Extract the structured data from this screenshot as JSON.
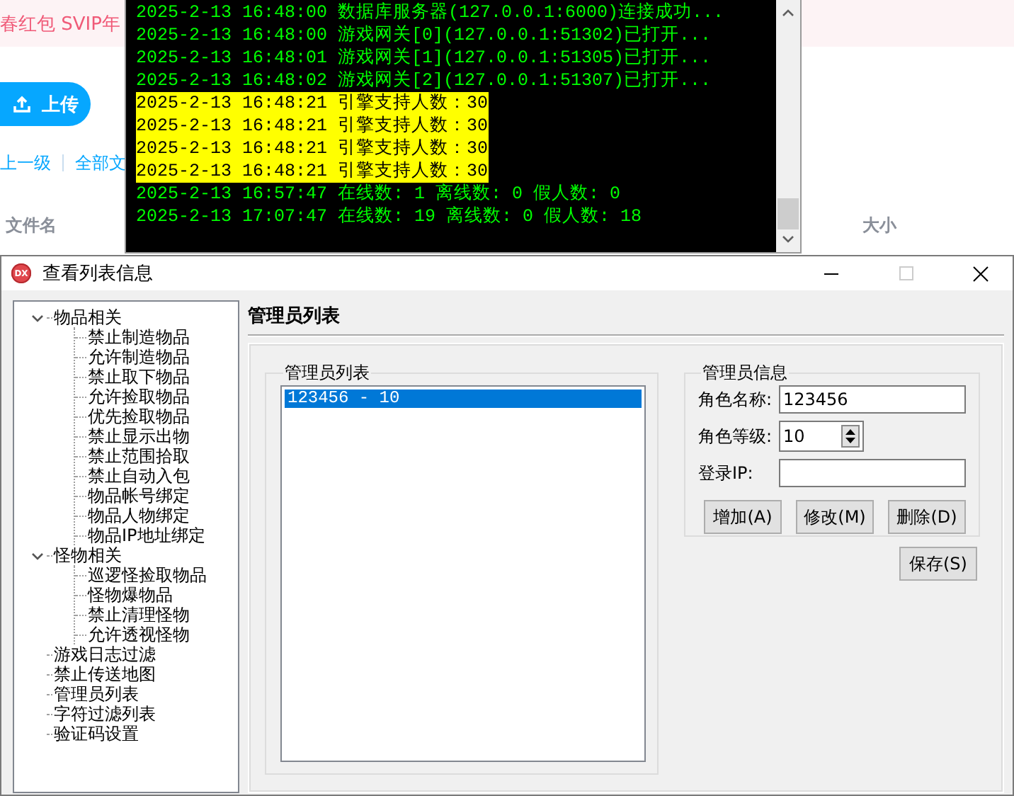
{
  "browser": {
    "promo_text": "春红包 SVIP年",
    "upload_button": "上传",
    "breadcrumb": [
      {
        "label": "上一级"
      },
      {
        "label": "全部文"
      }
    ],
    "columns": [
      "文件名",
      "大小"
    ]
  },
  "console": {
    "lines": [
      {
        "text": "2025-2-13 16:48:00 数据库服务器(127.0.0.1:6000)连接成功...",
        "highlighted": false
      },
      {
        "text": "2025-2-13 16:48:00 游戏网关[0](127.0.0.1:51302)已打开...",
        "highlighted": false
      },
      {
        "text": "2025-2-13 16:48:01 游戏网关[1](127.0.0.1:51305)已打开...",
        "highlighted": false
      },
      {
        "text": "2025-2-13 16:48:02 游戏网关[2](127.0.0.1:51307)已打开...",
        "highlighted": false
      },
      {
        "text": "2025-2-13 16:48:21 引擎支持人数：30",
        "highlighted": true
      },
      {
        "text": "2025-2-13 16:48:21 引擎支持人数：30",
        "highlighted": true
      },
      {
        "text": "2025-2-13 16:48:21 引擎支持人数：30",
        "highlighted": true
      },
      {
        "text": "2025-2-13 16:48:21 引擎支持人数：30",
        "highlighted": true
      },
      {
        "text": "2025-2-13 16:57:47 在线数: 1 离线数: 0 假人数: 0",
        "highlighted": false
      },
      {
        "text": "2025-2-13 17:07:47 在线数: 19 离线数: 0 假人数: 18",
        "highlighted": false
      }
    ]
  },
  "dialog": {
    "title": "查看列表信息",
    "icon_label": "DX",
    "tree": [
      {
        "label": "物品相关",
        "expanded": true,
        "children": [
          {
            "label": "禁止制造物品"
          },
          {
            "label": "允许制造物品"
          },
          {
            "label": "禁止取下物品"
          },
          {
            "label": "允许捡取物品"
          },
          {
            "label": "优先捡取物品"
          },
          {
            "label": "禁止显示出物"
          },
          {
            "label": "禁止范围拾取"
          },
          {
            "label": "禁止自动入包"
          },
          {
            "label": "物品帐号绑定"
          },
          {
            "label": "物品人物绑定"
          },
          {
            "label": "物品IP地址绑定"
          }
        ]
      },
      {
        "label": "怪物相关",
        "expanded": true,
        "children": [
          {
            "label": "巡逻怪捡取物品"
          },
          {
            "label": "怪物爆物品"
          },
          {
            "label": "禁止清理怪物"
          },
          {
            "label": "允许透视怪物"
          }
        ]
      },
      {
        "label": "游戏日志过滤"
      },
      {
        "label": "禁止传送地图"
      },
      {
        "label": "管理员列表"
      },
      {
        "label": "字符过滤列表"
      },
      {
        "label": "验证码设置"
      }
    ],
    "section_title": "管理员列表",
    "list_group": {
      "title": "管理员列表",
      "items": [
        {
          "text": "123456 - 10",
          "selected": true
        }
      ]
    },
    "info_group": {
      "title": "管理员信息",
      "fields": [
        {
          "kind": "text",
          "label": "角色名称:",
          "value": "123456"
        },
        {
          "kind": "spin",
          "label": "角色等级:",
          "value": "10"
        },
        {
          "kind": "text",
          "label": "登录IP:"
        }
      ],
      "buttons": [
        "增加(A)",
        "修改(M)",
        "删除(D)"
      ]
    },
    "save_button": "保存(S)"
  }
}
